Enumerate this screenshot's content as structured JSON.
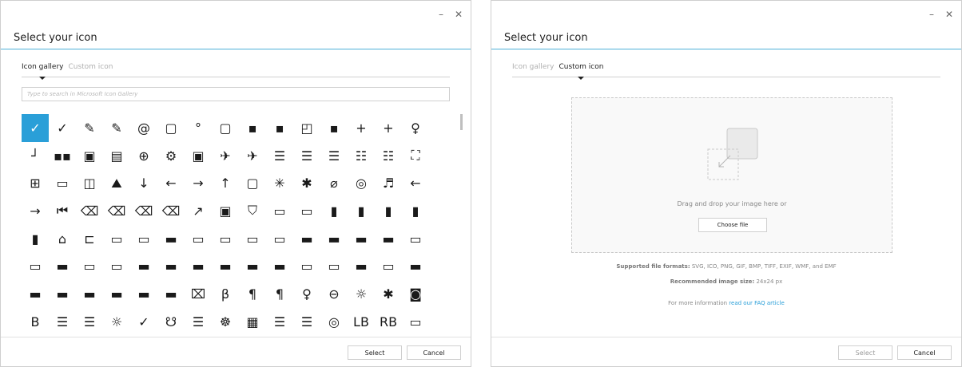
{
  "window_controls": {
    "minimize": "–",
    "close": "✕"
  },
  "left_dialog": {
    "title": "Select your icon",
    "tabs": [
      {
        "label": "Icon gallery",
        "active": true
      },
      {
        "label": "Custom icon",
        "active": false
      }
    ],
    "search_placeholder": "Type to search in Microsoft Icon Gallery",
    "icons": [
      "✓",
      "✓",
      "✎",
      "✎",
      "@",
      "▢",
      "°",
      "▢",
      "▪",
      "▪",
      "◰",
      "▪",
      "+",
      "+",
      "♀",
      "┘",
      "▪▪",
      "▣",
      "▤",
      "⊕",
      "⚙",
      "▣",
      "✈",
      "✈",
      "☰",
      "☰",
      "☰",
      "☷",
      "☷",
      "⛶",
      "⊞",
      "▭",
      "◫",
      "⛰",
      "↓",
      "←",
      "→",
      "↑",
      "▢",
      "✳",
      "✱",
      "⌀",
      "◎",
      "♬",
      "←",
      "→",
      "⏮",
      "⌫",
      "⌫",
      "⌫",
      "⌫",
      "↗",
      "▣",
      "⛉",
      "▭",
      "▭",
      "▮",
      "▮",
      "▮",
      "▮",
      "▮",
      "⌂",
      "⊏",
      "▭",
      "▭",
      "▬",
      "▭",
      "▭",
      "▭",
      "▭",
      "▬",
      "▬",
      "▬",
      "▬",
      "▭",
      "▭",
      "▬",
      "▭",
      "▭",
      "▬",
      "▬",
      "▬",
      "▬",
      "▬",
      "▬",
      "▭",
      "▭",
      "▬",
      "▭",
      "▬",
      "▬",
      "▬",
      "▬",
      "▬",
      "▬",
      "▬",
      "⌧",
      "β",
      "¶",
      "¶",
      "♀",
      "⊖",
      "☼",
      "✱",
      "◙",
      "B",
      "☰",
      "☰",
      "☼",
      "✓",
      "☋",
      "☰",
      "☸",
      "▦",
      "☰",
      "☰",
      "◎",
      "LB",
      "RB",
      "▭",
      "▭",
      "Ⓐ",
      "Ⓑ",
      "⊜",
      "Ⓐ",
      "Ⓧ",
      "Ⓨ",
      "☕"
    ],
    "selected_index": 0,
    "buttons": {
      "select": "Select",
      "cancel": "Cancel"
    }
  },
  "right_dialog": {
    "title": "Select your icon",
    "tabs": [
      {
        "label": "Icon gallery",
        "active": false
      },
      {
        "label": "Custom icon",
        "active": true
      }
    ],
    "dropzone": {
      "text": "Drag and drop your image here or",
      "choose_button": "Choose file"
    },
    "formats_label": "Supported file formats:",
    "formats_value": "SVG, ICO, PNG, GIF, BMP, TIFF, EXIF, WMF, and EMF",
    "size_label": "Recommended image size:",
    "size_value": "24x24 px",
    "more_info_prefix": "For more information",
    "more_info_link": "read our FAQ article",
    "buttons": {
      "select": "Select",
      "cancel": "Cancel"
    }
  }
}
